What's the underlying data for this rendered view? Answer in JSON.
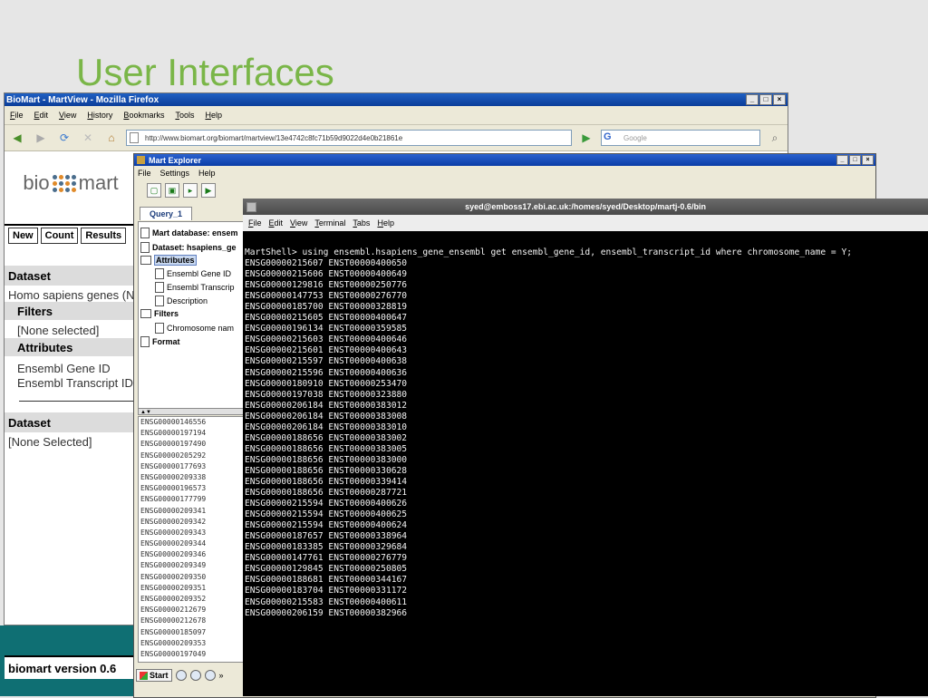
{
  "slide": {
    "title": "User Interfaces"
  },
  "firefox": {
    "title": "BioMart - MartView - Mozilla Firefox",
    "window_buttons": [
      "_",
      "□",
      "×"
    ],
    "menu": [
      "File",
      "Edit",
      "View",
      "History",
      "Bookmarks",
      "Tools",
      "Help"
    ],
    "url": "http://www.biomart.org/biomart/martview/13e4742c8fc71b59d9022d4e0b21861e",
    "search_placeholder": "Google",
    "search_engine": "G"
  },
  "biomart": {
    "logo_left": "bio",
    "logo_right": "mart",
    "buttons": [
      "New",
      "Count",
      "Results"
    ],
    "dataset_heading": "Dataset",
    "dataset_value": "Homo sapiens genes (N",
    "filters_heading": "Filters",
    "filters_value": "[None selected]",
    "attributes_heading": "Attributes",
    "attribute_1": "Ensembl Gene ID",
    "attribute_2": "Ensembl Transcript ID",
    "dataset2_heading": "Dataset",
    "dataset2_value": "[None Selected]",
    "version": "biomart version 0.6"
  },
  "mart_explorer": {
    "title": "Mart Explorer",
    "window_buttons": [
      "_",
      "□",
      "×"
    ],
    "menu": [
      "File",
      "Settings",
      "Help"
    ],
    "tab": "Query_1",
    "tree": {
      "mart_database": "Mart database: ensem",
      "dataset": "Dataset: hsapiens_ge",
      "attributes": "Attributes",
      "attr_gene": "Ensembl Gene ID",
      "attr_transcript": "Ensembl Transcrip",
      "attr_description": "Description",
      "filters": "Filters",
      "filter_chrom": "Chromosome nam",
      "format": "Format"
    },
    "results": [
      "ENSG00000146556",
      "ENSG00000197194",
      "ENSG00000197490",
      "ENSG00000205292",
      "ENSG00000177693",
      "ENSG00000209338",
      "ENSG00000196573",
      "ENSG00000177799",
      "ENSG00000209341",
      "ENSG00000209342",
      "ENSG00000209343",
      "ENSG00000209344",
      "ENSG00000209346",
      "ENSG00000209349",
      "ENSG00000209350",
      "ENSG00000209351",
      "ENSG00000209352",
      "ENSG00000212679",
      "ENSG00000212678",
      "ENSG00000185097",
      "ENSG00000209353",
      "ENSG00000197049"
    ],
    "taskbar_start": "Start"
  },
  "terminal": {
    "title": "syed@emboss17.ebi.ac.uk:/homes/syed/Desktop/martj-0.6/bin",
    "menu": [
      "File",
      "Edit",
      "View",
      "Terminal",
      "Tabs",
      "Help"
    ],
    "command": "MartShell> using ensembl.hsapiens_gene_ensembl get ensembl_gene_id, ensembl_transcript_id where chromosome_name = Y;",
    "rows": [
      "ENSG00000215607 ENST00000400650",
      "ENSG00000215606 ENST00000400649",
      "ENSG00000129816 ENST00000250776",
      "ENSG00000147753 ENST00000276770",
      "ENSG00000185700 ENST00000328819",
      "ENSG00000215605 ENST00000400647",
      "ENSG00000196134 ENST00000359585",
      "ENSG00000215603 ENST00000400646",
      "ENSG00000215601 ENST00000400643",
      "ENSG00000215597 ENST00000400638",
      "ENSG00000215596 ENST00000400636",
      "ENSG00000180910 ENST00000253470",
      "ENSG00000197038 ENST00000323880",
      "ENSG00000206184 ENST00000383012",
      "ENSG00000206184 ENST00000383008",
      "ENSG00000206184 ENST00000383010",
      "ENSG00000188656 ENST00000383002",
      "ENSG00000188656 ENST00000383005",
      "ENSG00000188656 ENST00000383000",
      "ENSG00000188656 ENST00000330628",
      "ENSG00000188656 ENST00000339414",
      "ENSG00000188656 ENST00000287721",
      "ENSG00000215594 ENST00000400626",
      "ENSG00000215594 ENST00000400625",
      "ENSG00000215594 ENST00000400624",
      "ENSG00000187657 ENST00000338964",
      "ENSG00000183385 ENST00000329684",
      "ENSG00000147761 ENST00000276779",
      "ENSG00000129845 ENST00000250805",
      "ENSG00000188681 ENST00000344167",
      "ENSG00000183704 ENST00000331172",
      "ENSG00000215583 ENST00000400611",
      "ENSG00000206159 ENST00000382966"
    ]
  }
}
